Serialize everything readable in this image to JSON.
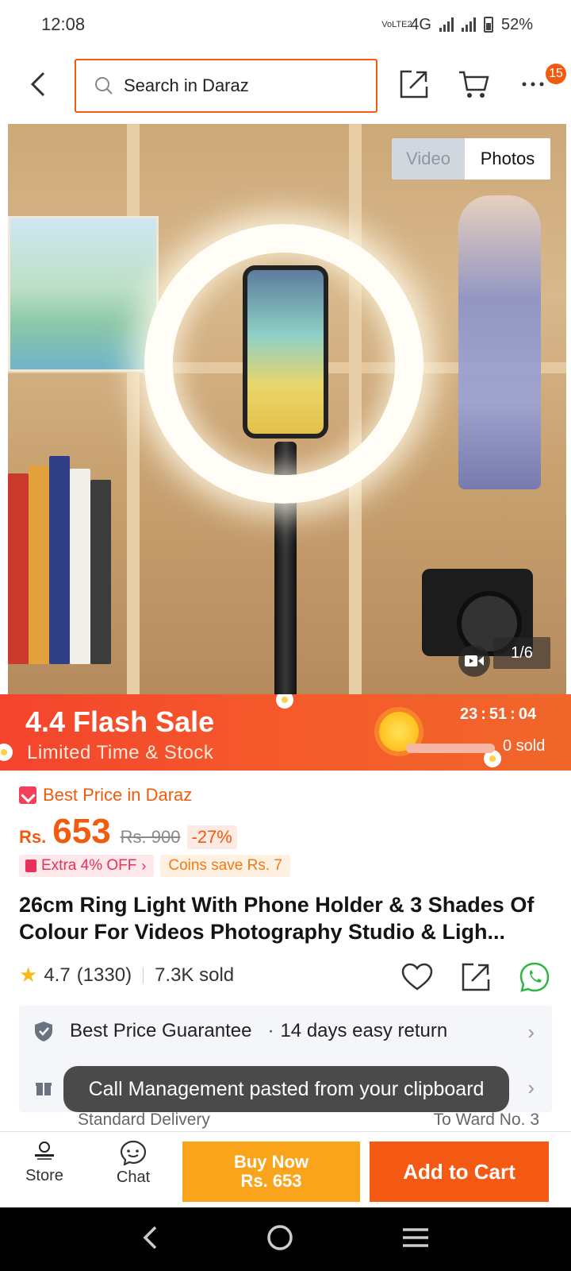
{
  "status_bar": {
    "time": "12:08",
    "net_label": "VoLTE2",
    "network": "4G",
    "battery": "52%"
  },
  "header": {
    "search_placeholder": "Search in Daraz",
    "cart_badge": "15"
  },
  "gallery": {
    "tab_video": "Video",
    "tab_photos": "Photos",
    "counter": "1/6"
  },
  "flash_sale": {
    "title": "4.4 Flash Sale",
    "subtitle": "Limited Time & Stock",
    "timer": {
      "hours": "23",
      "minutes": "51",
      "seconds": "04",
      "sep": ":"
    },
    "sold_label": "0 sold",
    "sold_fraction": 0.0
  },
  "product": {
    "best_price_label": "Best Price in Daraz",
    "currency": "Rs.",
    "price": "653",
    "old_price": "Rs. 900",
    "discount": "-27%",
    "extra_off": "Extra 4% OFF",
    "coins": "Coins save Rs. 7",
    "title": "26cm Ring Light With Phone Holder & 3 Shades Of Colour For Videos Photography Studio & Ligh...",
    "rating": "4.7",
    "reviews": "(1330)",
    "sold": "7.3K sold"
  },
  "services": {
    "guarantee": "Best Price Guarantee",
    "dot": "·",
    "returns": "14 days easy return",
    "delivery_type": "Standard Delivery",
    "delivery_to": "To Ward No. 3"
  },
  "toast": "Call Management pasted from your clipboard",
  "bottom_bar": {
    "store": "Store",
    "chat": "Chat",
    "buy_now": "Buy Now",
    "buy_price": "Rs. 653",
    "add_to_cart": "Add to Cart"
  },
  "colors": {
    "brand": "#f25a0d",
    "buy_now": "#f9a41a",
    "add_to_cart": "#f55a14",
    "flash": "#f4442d"
  }
}
